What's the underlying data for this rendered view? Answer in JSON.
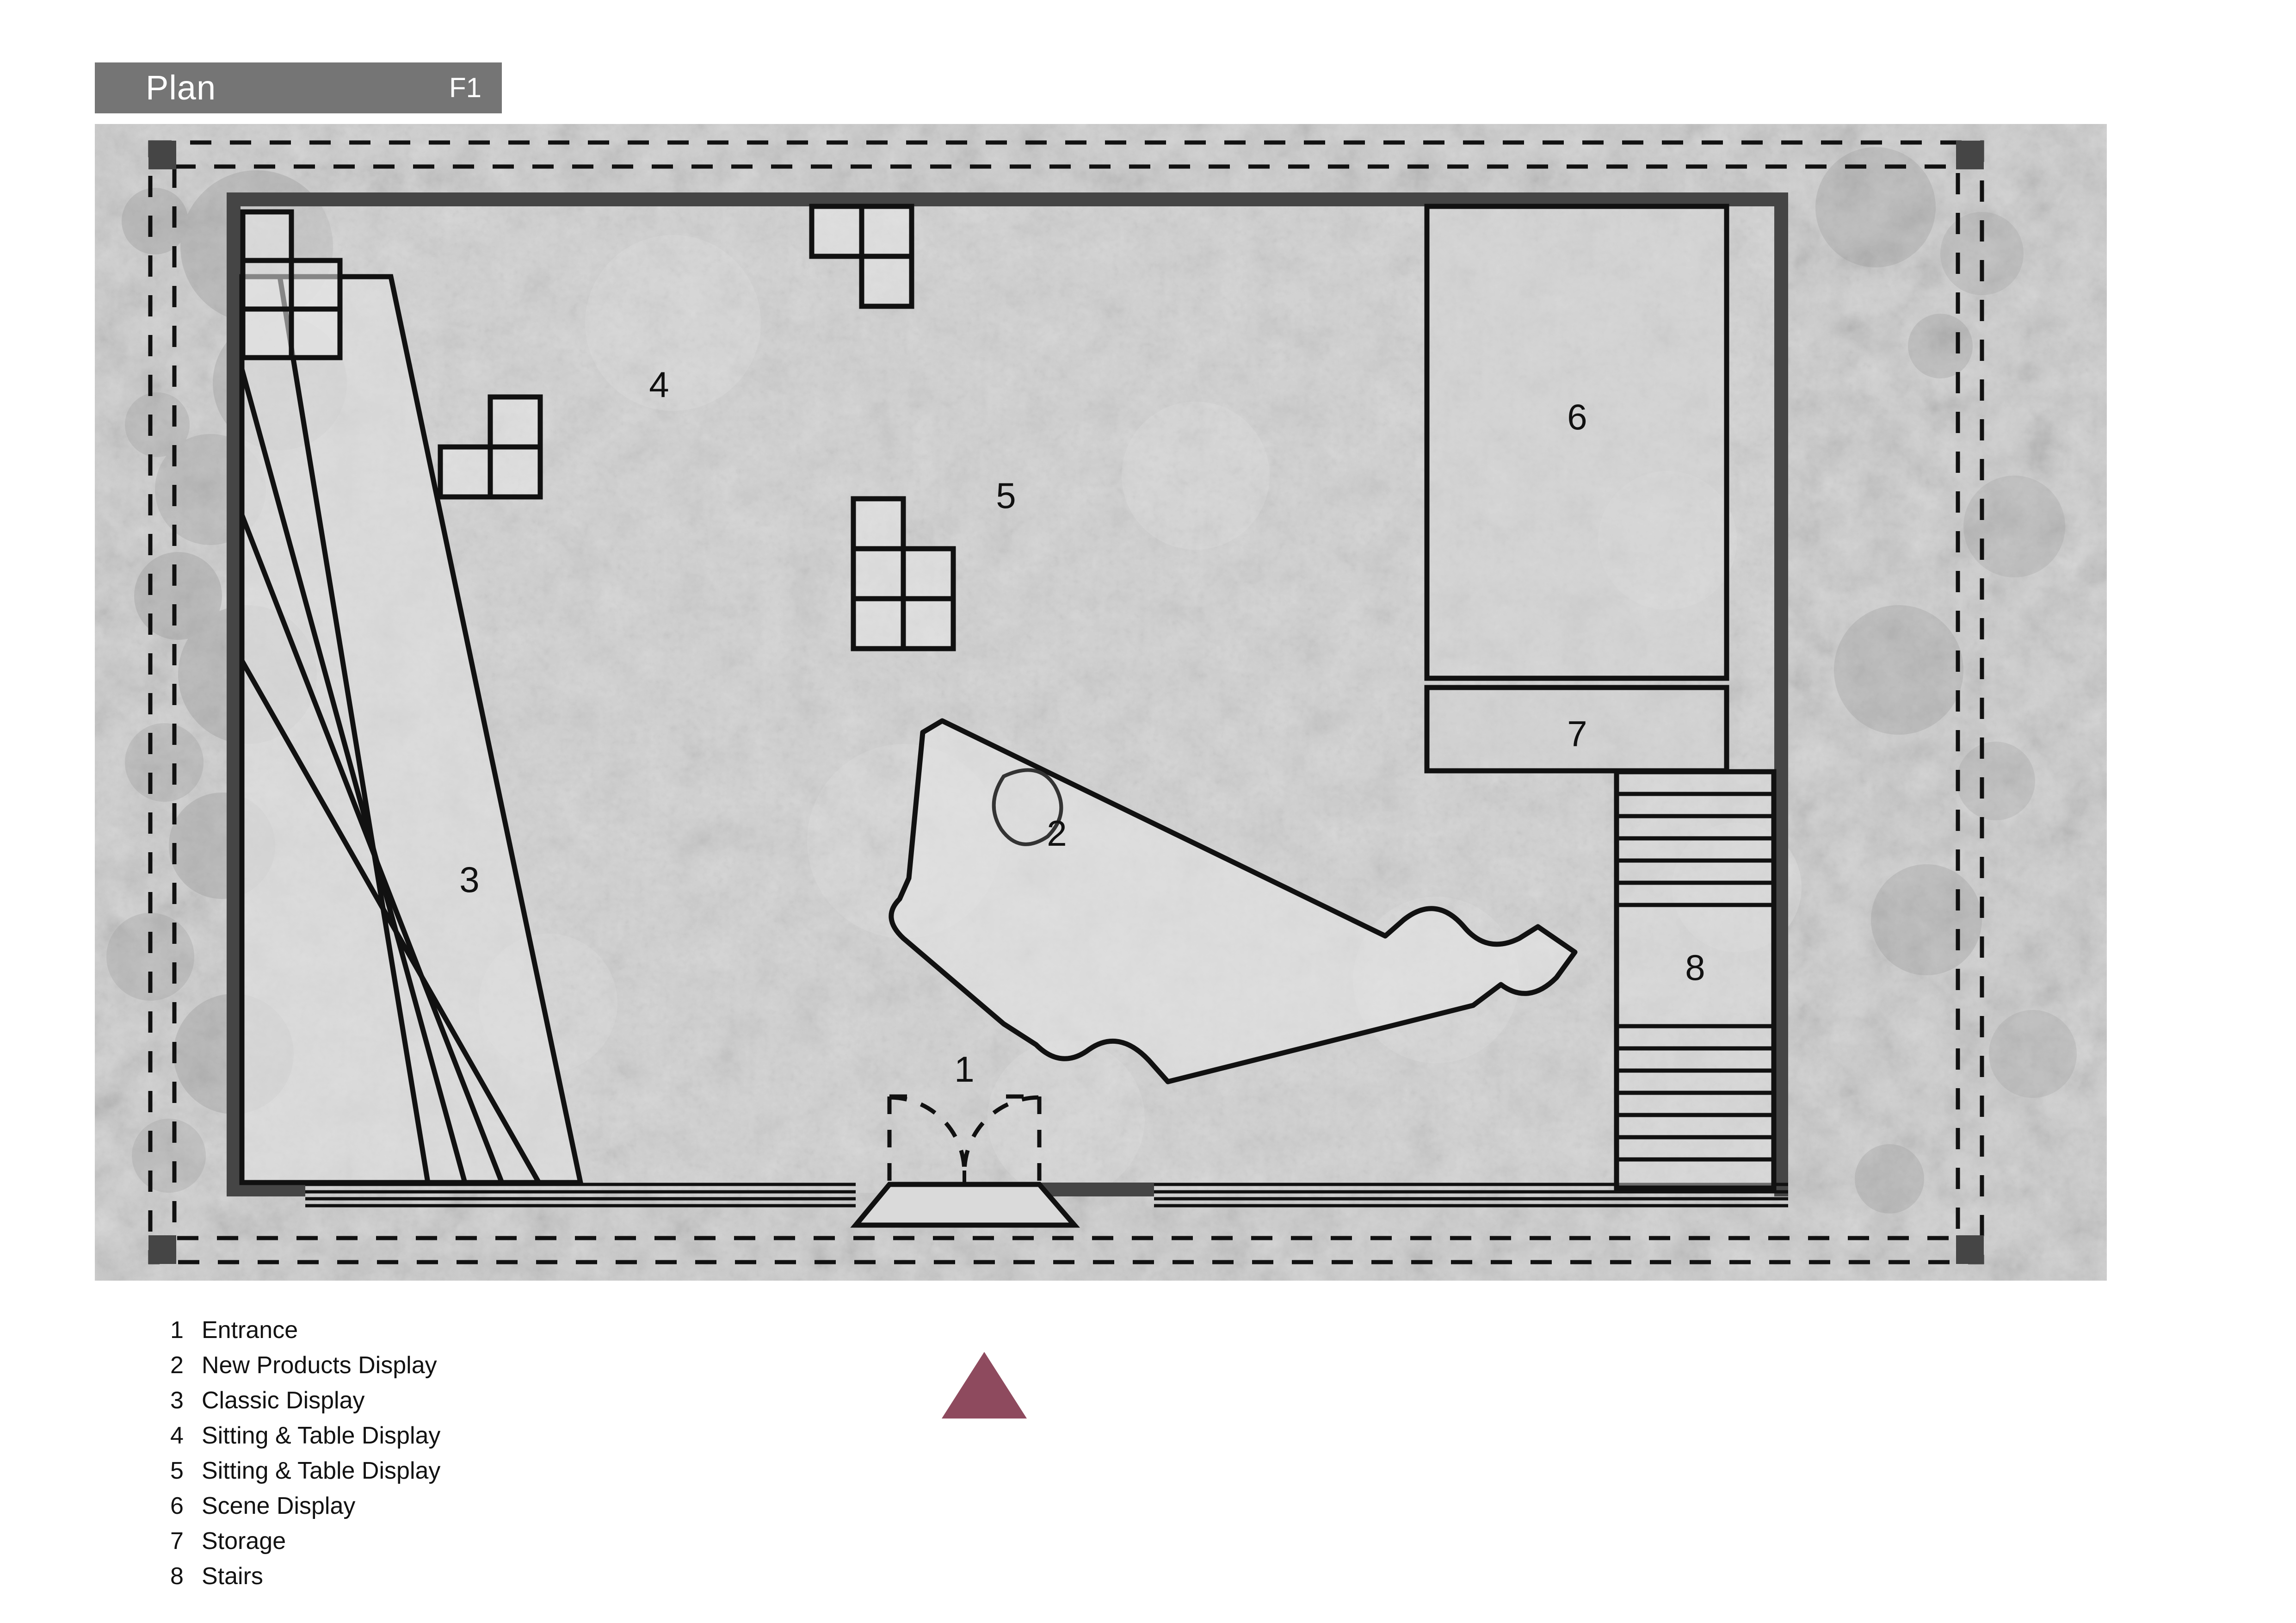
{
  "title_bar": {
    "label": "Plan",
    "level": "F1"
  },
  "plan": {
    "rooms": [
      {
        "key": "1",
        "number": "1",
        "name": "Entrance"
      },
      {
        "key": "2",
        "number": "2",
        "name": "New Products Display"
      },
      {
        "key": "3",
        "number": "3",
        "name": "Classic Display"
      },
      {
        "key": "4",
        "number": "4",
        "name": "Sitting & Table Display"
      },
      {
        "key": "5",
        "number": "5",
        "name": "Sitting & Table Display"
      },
      {
        "key": "6",
        "number": "6",
        "name": "Scene Display"
      },
      {
        "key": "7",
        "number": "7",
        "name": "Storage"
      },
      {
        "key": "8",
        "number": "8",
        "name": "Stairs"
      }
    ],
    "markers": {
      "m1": "1",
      "m2": "2",
      "m3": "3",
      "m4": "4",
      "m5": "5",
      "m6": "6",
      "m7": "7",
      "m8": "8"
    }
  },
  "legend": {
    "items": [
      {
        "number": "1",
        "label": "Entrance"
      },
      {
        "number": "2",
        "label": "New Products Display"
      },
      {
        "number": "3",
        "label": "Classic Display"
      },
      {
        "number": "4",
        "label": "Sitting & Table Display"
      },
      {
        "number": "5",
        "label": "Sitting & Table Display"
      },
      {
        "number": "6",
        "label": "Scene Display"
      },
      {
        "number": "7",
        "label": "Storage"
      },
      {
        "number": "8",
        "label": "Stairs"
      }
    ]
  },
  "north_marker": {
    "shape": "triangle",
    "color": "#8E4A5E"
  },
  "colors": {
    "title_bar_bg": "#757575",
    "title_text": "#FFFFFF",
    "wall": "#454545",
    "line": "#111111",
    "background_paper": "#FFFFFF",
    "floor_texture_light": "#D4D4D4",
    "floor_texture_dark": "#A9A9A9",
    "legend_text": "#121212",
    "north_triangle": "#8E4A5E"
  }
}
